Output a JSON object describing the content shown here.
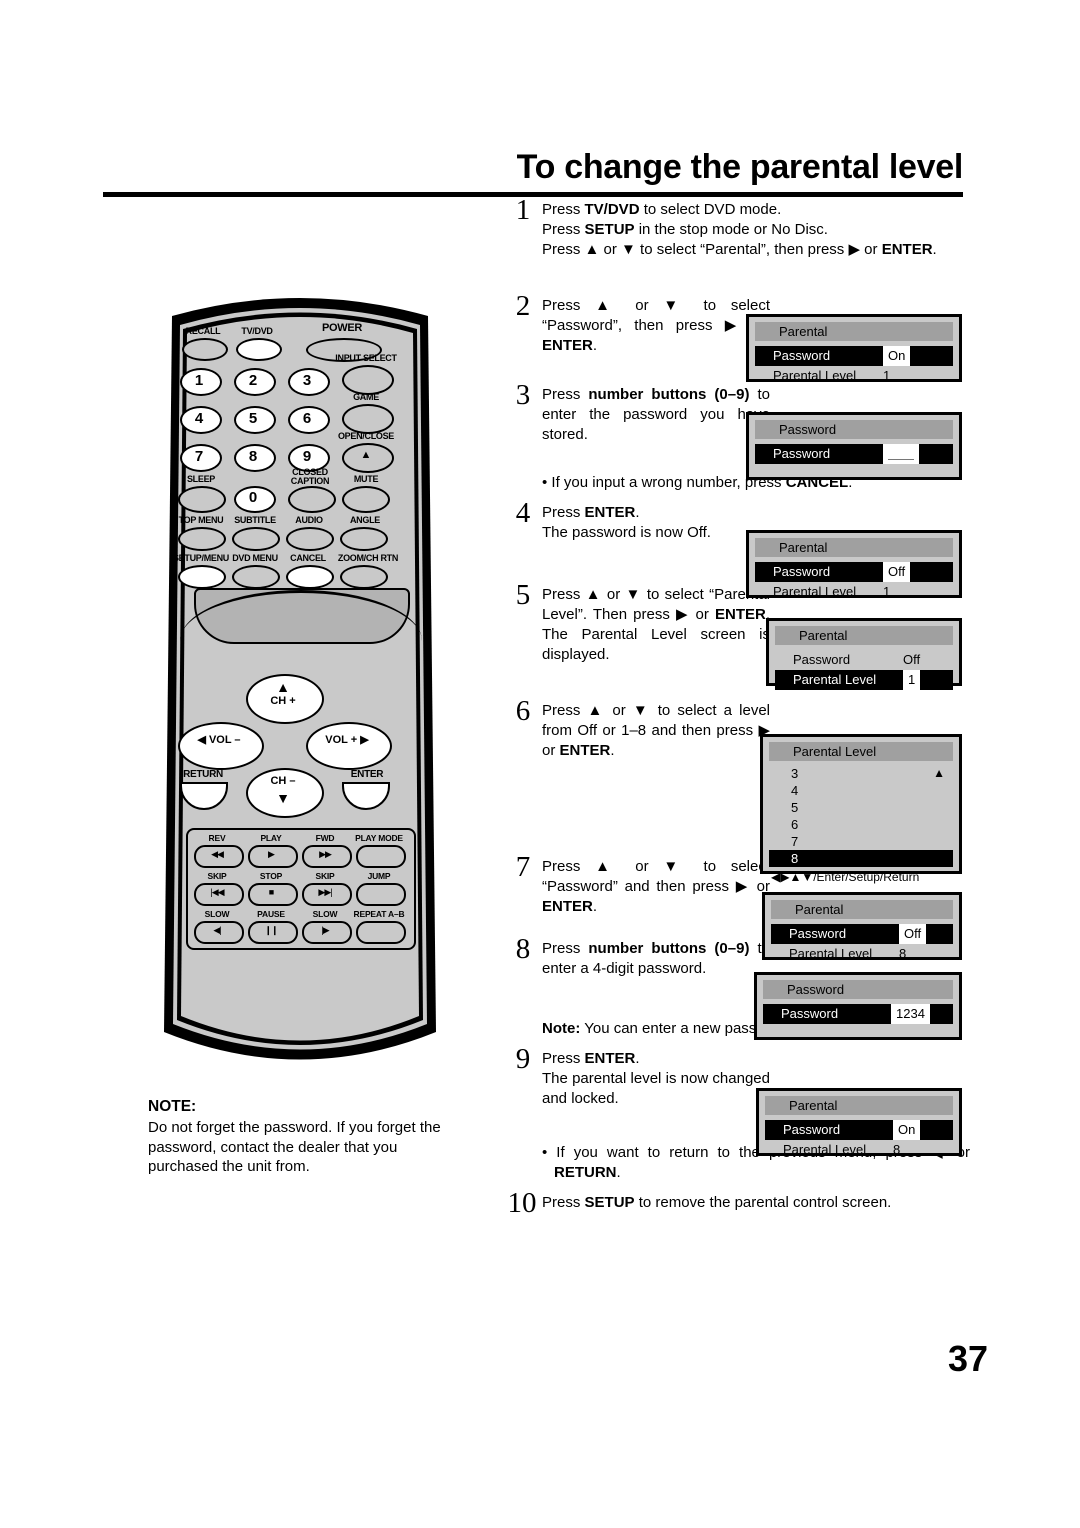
{
  "page": {
    "title": "To change the parental level",
    "number": "37"
  },
  "steps": [
    {
      "num": "1",
      "lines": [
        "Press |TV/DVD| to select DVD mode.",
        "Press |SETUP| in the stop mode or No Disc.",
        "Press ▲ or ▼ to select “Parental”, then press ▶ or |ENTER|."
      ]
    },
    {
      "num": "2",
      "lines": [
        "Press ▲ or ▼ to select “Password”, then press ▶ or |ENTER|."
      ]
    },
    {
      "num": "3",
      "lines": [
        "Press |number buttons (0–9)| to enter the password you have stored."
      ]
    },
    {
      "num": "4",
      "lines": [
        "Press |ENTER|.",
        "The password is now Off."
      ]
    },
    {
      "num": "5",
      "lines": [
        "Press ▲ or ▼ to select “Parental Level”. Then press ▶ or |ENTER|. The Parental Level screen is displayed."
      ]
    },
    {
      "num": "6",
      "lines": [
        "Press ▲ or ▼ to select a level from Off or 1–8 and then press ▶ or |ENTER|."
      ]
    },
    {
      "num": "7",
      "lines": [
        "Press ▲ or ▼ to select “Password” and then press ▶ or |ENTER|."
      ]
    },
    {
      "num": "8",
      "lines": [
        "Press |number buttons (0–9)| to enter a 4-digit password."
      ]
    },
    {
      "num": "9",
      "lines": [
        "Press |ENTER|.",
        "The parental level is now changed and locked."
      ]
    },
    {
      "num": "10",
      "lines": [
        "Press |SETUP| to remove the parental control screen."
      ]
    }
  ],
  "bullets": {
    "after_step3": "• If you input a wrong number, press |CANCEL|.",
    "after_step9": "• If you want to return to the previous menu, press ◀ or |RETURN|."
  },
  "inline_note": "|Note:| You can enter a new password.",
  "note_block": {
    "title": "NOTE:",
    "text": "Do not forget the password. If you forget the password, contact the dealer that you purchased the unit from."
  },
  "osd_screens": [
    {
      "id": "osd-step2",
      "title": "Parental",
      "rows": [
        {
          "label": "Password",
          "value": "On",
          "selected": true,
          "boxed": true
        },
        {
          "label": "Parental Level",
          "value": "1",
          "selected": false,
          "boxed": false
        }
      ]
    },
    {
      "id": "osd-step3",
      "title": "Password",
      "rows": [
        {
          "label": "Password",
          "value": "＿＿",
          "selected": true,
          "boxed": true
        }
      ]
    },
    {
      "id": "osd-step4",
      "title": "Parental",
      "rows": [
        {
          "label": "Password",
          "value": "Off",
          "selected": true,
          "boxed": true
        },
        {
          "label": "Parental Level",
          "value": "1",
          "selected": false,
          "boxed": false
        }
      ]
    },
    {
      "id": "osd-step5",
      "title": "Parental",
      "rows": [
        {
          "label": "Password",
          "value": "Off",
          "selected": false,
          "boxed": false
        },
        {
          "label": "Parental Level",
          "value": "1",
          "selected": true,
          "boxed": true
        }
      ]
    },
    {
      "id": "osd-step7",
      "title": "Parental",
      "rows": [
        {
          "label": "Password",
          "value": "Off",
          "selected": true,
          "boxed": true
        },
        {
          "label": "Parental Level",
          "value": "8",
          "selected": false,
          "boxed": false
        }
      ]
    },
    {
      "id": "osd-step8",
      "title": "Password",
      "rows": [
        {
          "label": "Password",
          "value": "1234",
          "selected": true,
          "boxed": true
        }
      ]
    },
    {
      "id": "osd-step9",
      "title": "Parental",
      "rows": [
        {
          "label": "Password",
          "value": "On",
          "selected": true,
          "boxed": true
        },
        {
          "label": "Parental Level",
          "value": "8",
          "selected": false,
          "boxed": false
        }
      ]
    }
  ],
  "osd_level_screen": {
    "title": "Parental Level",
    "items": [
      "3",
      "4",
      "5",
      "6",
      "7",
      "8"
    ],
    "selected_index": 5,
    "up_arrow": "▲",
    "footer": "◀▶▲▼/Enter/Setup/Return"
  },
  "remote": {
    "top_buttons": [
      {
        "label": "RECALL",
        "style": "oval"
      },
      {
        "label": "TV/DVD",
        "style": "oval-white"
      },
      {
        "label": "POWER",
        "style": "wide"
      }
    ],
    "side_buttons": [
      {
        "label": "INPUT SELECT"
      },
      {
        "label": "GAME"
      },
      {
        "label": "OPEN/CLOSE",
        "glyph": "▲"
      },
      {
        "label": "MUTE"
      },
      {
        "label": "ANGLE"
      },
      {
        "label": "ZOOM/CH RTN"
      }
    ],
    "numbers": [
      "1",
      "2",
      "3",
      "4",
      "5",
      "6",
      "7",
      "8",
      "9",
      "0"
    ],
    "function_labels": [
      "SLEEP",
      "CLOSED CAPTION",
      "TOP MENU",
      "SUBTITLE",
      "AUDIO",
      "SETUP/MENU",
      "DVD MENU",
      "CANCEL"
    ],
    "nav": {
      "ch_up": "CH +",
      "ch_down": "CH –",
      "vol_minus": "VOL –",
      "vol_plus": "VOL +",
      "return": "RETURN",
      "enter": "ENTER"
    },
    "transport": [
      {
        "label": "REV",
        "glyph": "◀◀"
      },
      {
        "label": "PLAY",
        "glyph": "▶"
      },
      {
        "label": "FWD",
        "glyph": "▶▶"
      },
      {
        "label": "PLAY MODE",
        "glyph": ""
      },
      {
        "label": "SKIP",
        "glyph": "|◀◀"
      },
      {
        "label": "STOP",
        "glyph": "■"
      },
      {
        "label": "SKIP",
        "glyph": "▶▶|"
      },
      {
        "label": "JUMP",
        "glyph": ""
      },
      {
        "label": "SLOW",
        "glyph": "◀|"
      },
      {
        "label": "PAUSE",
        "glyph": "❙❙"
      },
      {
        "label": "SLOW",
        "glyph": "|▶"
      },
      {
        "label": "REPEAT A–B",
        "glyph": ""
      }
    ]
  },
  "colors": {
    "remote_body": "#c9c9c9",
    "osd_background": "#c9c9c9",
    "osd_title_bar": "#a0a0a0",
    "osd_selected": "#000000",
    "text": "#000000"
  }
}
